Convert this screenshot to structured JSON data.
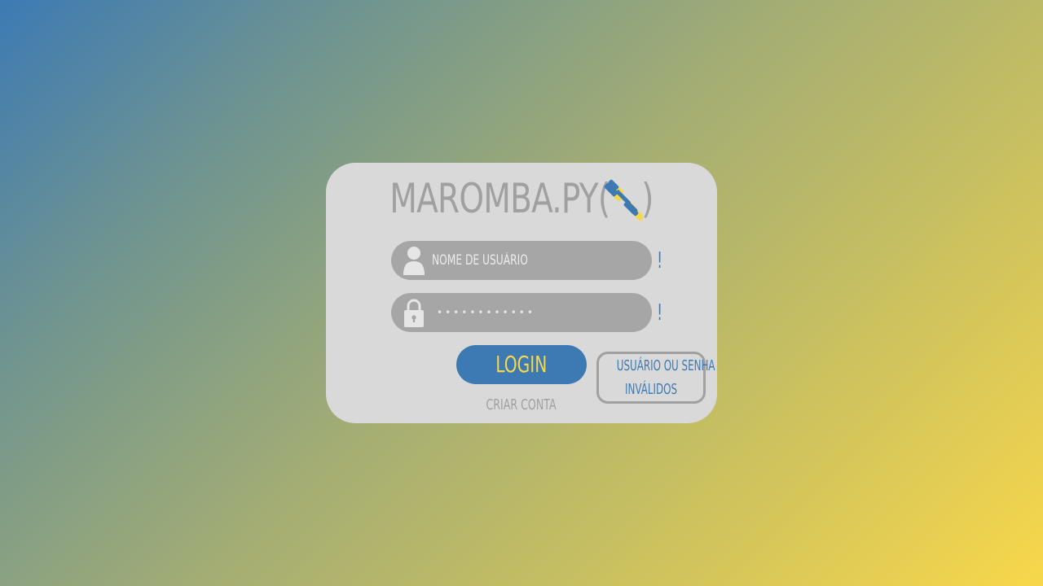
{
  "app": {
    "title": "MAROMBA.PY",
    "title_open_paren": "(",
    "title_close_paren": ")",
    "logo_icon": "dumbbell-icon"
  },
  "form": {
    "username": {
      "placeholder": "NOME DE USUÁRIO",
      "value": "",
      "icon": "user-icon",
      "warning": "!"
    },
    "password": {
      "value": "••••••••••••",
      "icon": "lock-icon",
      "warning": "!"
    },
    "login_label": "LOGIN",
    "create_account_label": "CRIAR CONTA",
    "error_message_line1": "USUÁRIO OU SENHA",
    "error_message_line2": "INVÁLIDOS"
  },
  "colors": {
    "primary_blue": "#3d7ab4",
    "accent_yellow": "#f6d84b",
    "card_bg": "#d9d9d9",
    "field_bg": "#a6a6a6",
    "muted_text": "#a0a0a0"
  }
}
